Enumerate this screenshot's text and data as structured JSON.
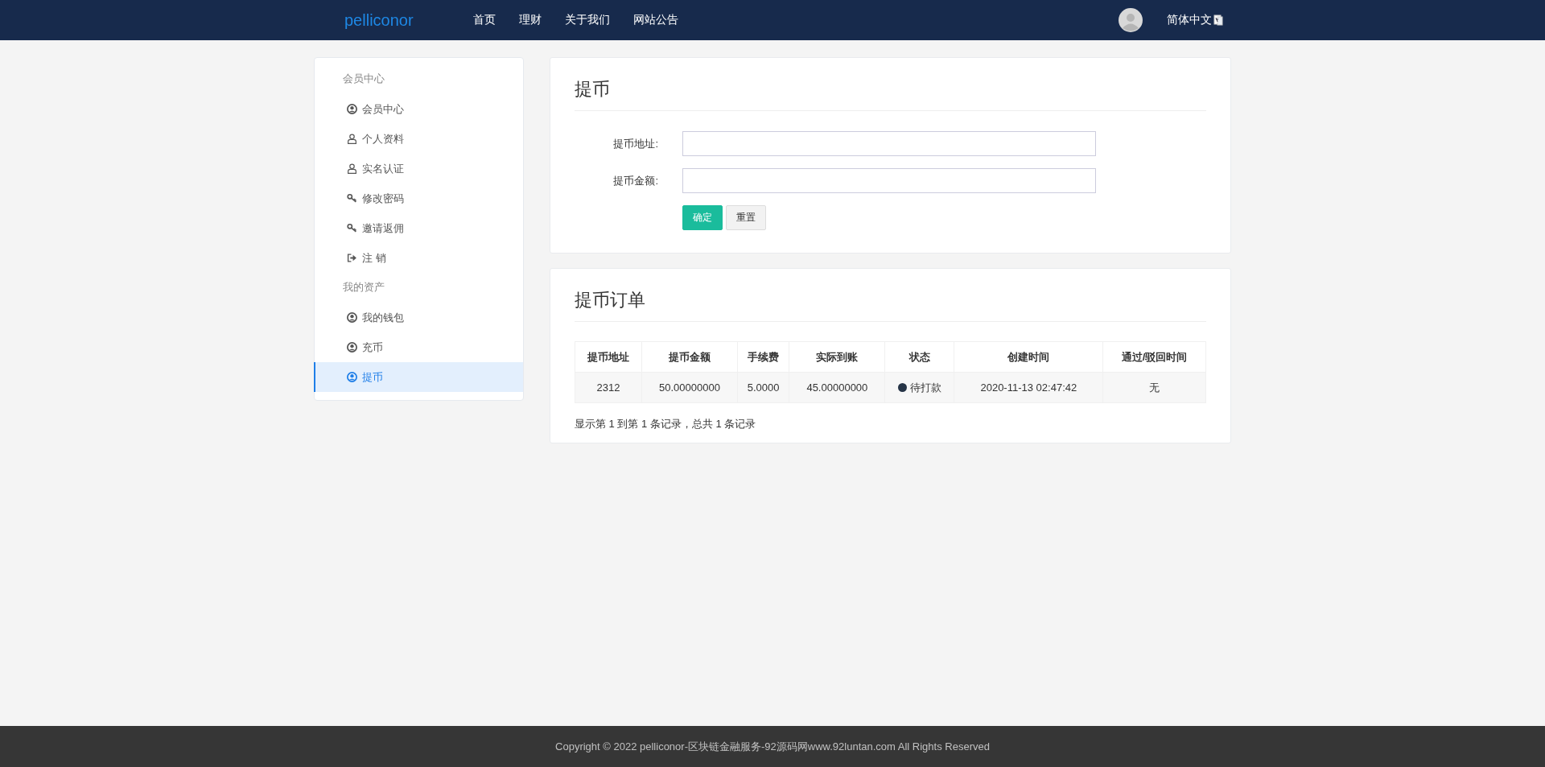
{
  "header": {
    "logo": "pelliconor",
    "nav": [
      {
        "label": "首页"
      },
      {
        "label": "理财"
      },
      {
        "label": "关于我们"
      },
      {
        "label": "网站公告"
      }
    ],
    "language": "简体中文"
  },
  "sidebar": {
    "sections": [
      {
        "title": "会员中心",
        "items": [
          {
            "label": "会员中心",
            "kind": "account",
            "selected": false
          },
          {
            "label": "个人资料",
            "kind": "profile",
            "selected": false
          },
          {
            "label": "实名认证",
            "kind": "profile",
            "selected": false
          },
          {
            "label": "修改密码",
            "kind": "security",
            "selected": false
          },
          {
            "label": "邀请返佣",
            "kind": "security",
            "selected": false
          },
          {
            "label": "注 销",
            "kind": "logout",
            "selected": false
          }
        ]
      },
      {
        "title": "我的资产",
        "items": [
          {
            "label": "我的钱包",
            "kind": "account",
            "selected": false
          },
          {
            "label": "充币",
            "kind": "account",
            "selected": false
          },
          {
            "label": "提币",
            "kind": "account",
            "selected": true
          }
        ]
      }
    ]
  },
  "withdraw_form": {
    "title": "提币",
    "fields": [
      {
        "label": "提币地址:"
      },
      {
        "label": "提币金额:"
      }
    ],
    "buttons": [
      {
        "label": "确定",
        "kind": "primary"
      },
      {
        "label": "重置",
        "kind": "default"
      }
    ]
  },
  "orders": {
    "title": "提币订单",
    "columns": [
      "提币地址",
      "提币金额",
      "手续费",
      "实际到账",
      "状态",
      "创建时间",
      "通过/驳回时间"
    ],
    "rows": [
      {
        "address": "2312",
        "amount": "50.00000000",
        "fee": "5.0000",
        "received": "45.00000000",
        "status": "待打款",
        "created": "2020-11-13 02:47:42",
        "processed": "无"
      }
    ],
    "summary": "显示第 1 到第 1 条记录，总共 1 条记录"
  },
  "footer": "Copyright © 2022 pelliconor-区块链金融服务-92源码网www.92luntan.com All Rights Reserved"
}
